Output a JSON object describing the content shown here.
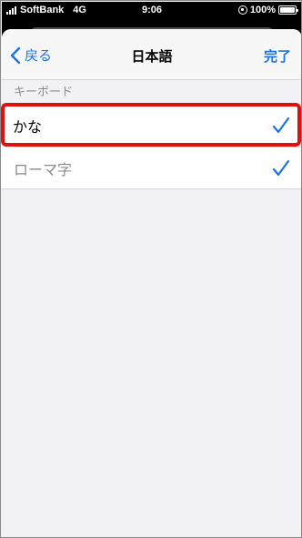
{
  "status_bar": {
    "carrier": "SoftBank",
    "network": "4G",
    "time": "9:06",
    "battery": "100%"
  },
  "nav": {
    "back_label": "戻る",
    "title": "日本語",
    "done_label": "完了"
  },
  "section": {
    "header": "キーボード",
    "items": [
      {
        "label": "かな",
        "checked": true
      },
      {
        "label": "ローマ字",
        "checked": true
      }
    ]
  },
  "colors": {
    "accent": "#1a74e8",
    "highlight": "#e20f0f"
  }
}
